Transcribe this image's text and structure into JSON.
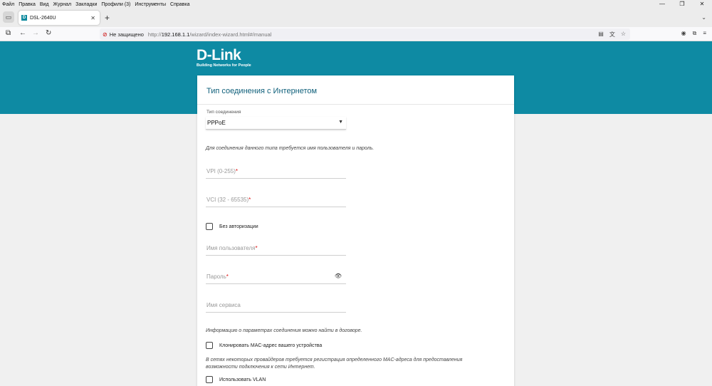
{
  "menubar": {
    "items": [
      "Файл",
      "Правка",
      "Вид",
      "Журнал",
      "Закладки",
      "Профили (3)",
      "Инструменты",
      "Справка"
    ],
    "window_controls": [
      "—",
      "❐",
      "✕"
    ]
  },
  "tab": {
    "title": "DSL-2640U",
    "favicon": "D",
    "close": "✕",
    "new_tab": "+"
  },
  "navbar": {
    "insecure_label": "Не защищено",
    "url_scheme": "http://",
    "url_host": "192.168.1.1",
    "url_path": "/wizard/index-wizard.html#/manual"
  },
  "brand": {
    "logo": "D-Link",
    "tagline": "Building Networks for People",
    "accent_color": "#0e8aa3"
  },
  "form": {
    "title": "Тип соединения с Интернетом",
    "connection_type_label": "Тип соединения",
    "connection_type_value": "PPPoE",
    "note_auth": "Для соединения данного типа требуется имя пользователя и пароль.",
    "vpi_placeholder": "VPI (0-255)",
    "vci_placeholder": "VCI (32 - 65535)",
    "required_mark": "*",
    "no_auth_label": "Без авторизации",
    "username_placeholder": "Имя пользователя",
    "password_placeholder": "Пароль",
    "service_placeholder": "Имя сервиса",
    "note_contract": "Информацию о параметрах соединения можно найти в договоре.",
    "clone_mac_label": "Клонировать MAC-адрес вашего устройства",
    "note_mac": "В сетях некоторых провайдеров требуется регистрация определенного MAC-адреса для предоставления возможности подключения к сети Интернет.",
    "use_vlan_label": "Использовать VLAN"
  }
}
